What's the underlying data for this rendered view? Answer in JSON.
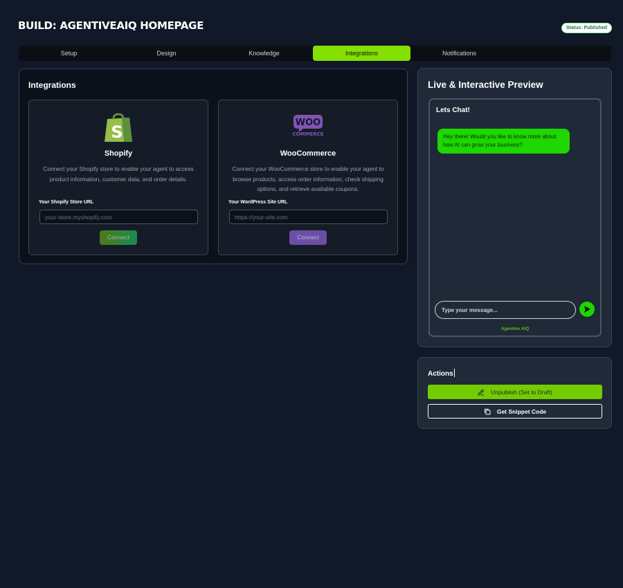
{
  "header": {
    "title": "BUILD: AGENTIVEAIQ HOMEPAGE",
    "status": "Status: Published"
  },
  "tabs": [
    {
      "label": "Setup",
      "active": false
    },
    {
      "label": "Design",
      "active": false
    },
    {
      "label": "Knowledge",
      "active": false
    },
    {
      "label": "Integrations",
      "active": true
    },
    {
      "label": "Notifications",
      "active": false
    }
  ],
  "integrations": {
    "heading": "Integrations",
    "cards": [
      {
        "icon": "shopify-bag-icon",
        "name": "Shopify",
        "description": "Connect your Shopify store to enable your agent to access product information, customer data, and order details.",
        "field_label": "Your Shopify Store URL",
        "placeholder": "your-store.myshopify.com",
        "button": "Connect"
      },
      {
        "icon": "woocommerce-logo-icon",
        "logo_text_1": "WOO",
        "logo_text_2": "COMMERCE",
        "name": "WooCommerce",
        "description": "Connect your WooCommerce store to enable your agent to browse products, access order information, check shipping options, and retrieve available coupons.",
        "field_label": "Your WordPress Site URL",
        "placeholder": "https://your-site.com",
        "button": "Connect"
      }
    ]
  },
  "preview": {
    "heading": "Live & Interactive Preview",
    "chat_title": "Lets Chat!",
    "bot_message": "Hey there! Would you like to know more about how AI can grow your business?",
    "input_placeholder": "Type your message...",
    "footer": "Agentive AIQ"
  },
  "actions": {
    "heading": "Actions",
    "unpublish": "Unpublish (Set to Draft)",
    "snippet": "Get Snippet Code"
  },
  "colors": {
    "background": "#111827",
    "accent_green": "#84e000",
    "chat_green": "#1ed600",
    "woo_purple": "#6b4fa7"
  }
}
